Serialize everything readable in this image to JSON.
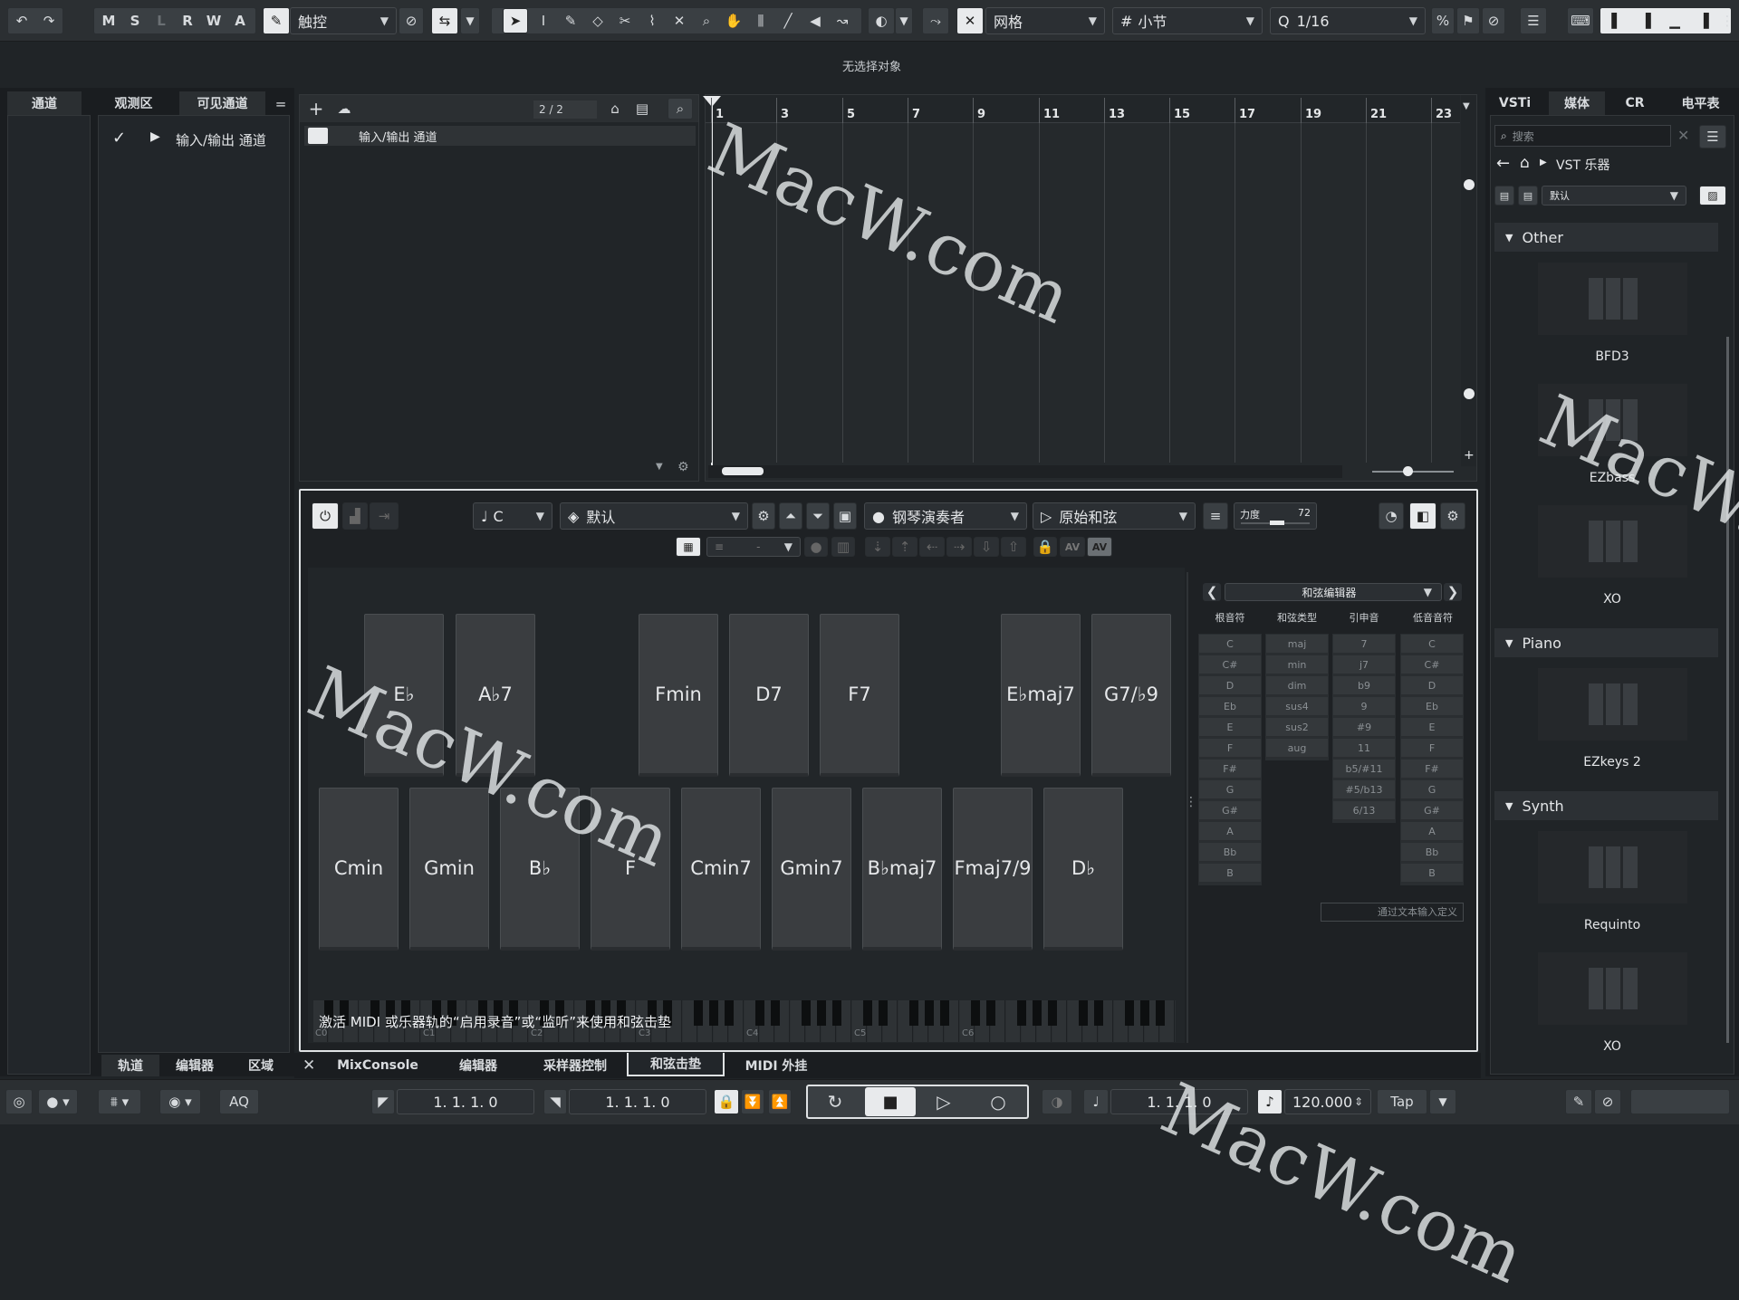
{
  "toolbar": {
    "msrwa": [
      "M",
      "S",
      "L",
      "R",
      "W",
      "A"
    ],
    "touch_mode": "触控",
    "grid_type": "网格",
    "grid_unit": "小节",
    "quantize": "1/16"
  },
  "info_line": {
    "text": "无选择对象"
  },
  "left_zone": {
    "tabs": [
      "通道",
      "观测区",
      "可见通道"
    ],
    "channel_name": "输入/输出 通道",
    "bottom_tabs": [
      "轨道",
      "编辑器",
      "区域"
    ]
  },
  "project": {
    "counter": "2 / 2",
    "track_name": "输入/输出 通道",
    "ruler": [
      "1",
      "3",
      "5",
      "7",
      "9",
      "11",
      "13",
      "15",
      "17",
      "19",
      "21",
      "23"
    ]
  },
  "chord_pads": {
    "key": "C",
    "preset": "默认",
    "player": "钢琴演奏者",
    "mode": "原始和弦",
    "velocity_label": "力度",
    "velocity_value": "72",
    "top_row": [
      "E♭",
      "A♭7",
      "Fmin",
      "D7",
      "F7",
      "E♭maj7",
      "G7/♭9"
    ],
    "bottom_row": [
      "Cmin",
      "Gmin",
      "B♭",
      "F",
      "Cmin7",
      "Gmin7",
      "B♭maj7",
      "Fmaj7/9",
      "D♭"
    ],
    "hint": "激活 MIDI 或乐器轨的“启用录音”或“监听”来使用和弦击垫",
    "octave_labels": [
      "C0",
      "C1",
      "C2",
      "C3",
      "C4",
      "C5",
      "C6"
    ]
  },
  "chord_editor": {
    "title": "和弦编辑器",
    "col_headers": [
      "根音符",
      "和弦类型",
      "引申音",
      "低音音符"
    ],
    "roots": [
      "C",
      "C#",
      "D",
      "Eb",
      "E",
      "F",
      "F#",
      "G",
      "G#",
      "A",
      "Bb",
      "B"
    ],
    "types": [
      "maj",
      "min",
      "dim",
      "sus4",
      "sus2",
      "aug"
    ],
    "tensions": [
      "7",
      "j7",
      "b9",
      "9",
      "#9",
      "11",
      "b5/#11",
      "#5/b13",
      "6/13"
    ],
    "bass": [
      "C",
      "C#",
      "D",
      "Eb",
      "E",
      "F",
      "F#",
      "G",
      "G#",
      "A",
      "Bb",
      "B"
    ],
    "text_input": "通过文本输入定义"
  },
  "lower_zone_tabs": [
    "MixConsole",
    "编辑器",
    "采样器控制",
    "和弦击垫",
    "MIDI 外挂"
  ],
  "right_zone": {
    "tabs": [
      "VSTi",
      "媒体",
      "CR",
      "电平表"
    ],
    "search_placeholder": "搜索",
    "breadcrumb": "VST 乐器",
    "preset": "默认",
    "categories": [
      {
        "name": "Other",
        "items": [
          "BFD3",
          "EZbass",
          "XO"
        ]
      },
      {
        "name": "Piano",
        "items": [
          "EZkeys 2"
        ]
      },
      {
        "name": "Synth",
        "items": [
          "Requinto",
          "XO"
        ]
      }
    ]
  },
  "transport": {
    "aq": "AQ",
    "left_locator": "1. 1. 1.   0",
    "right_locator": "1. 1. 1.   0",
    "position": "1. 1. 1.   0",
    "tempo": "120.000",
    "tap": "Tap"
  },
  "watermark": "MacW.com"
}
